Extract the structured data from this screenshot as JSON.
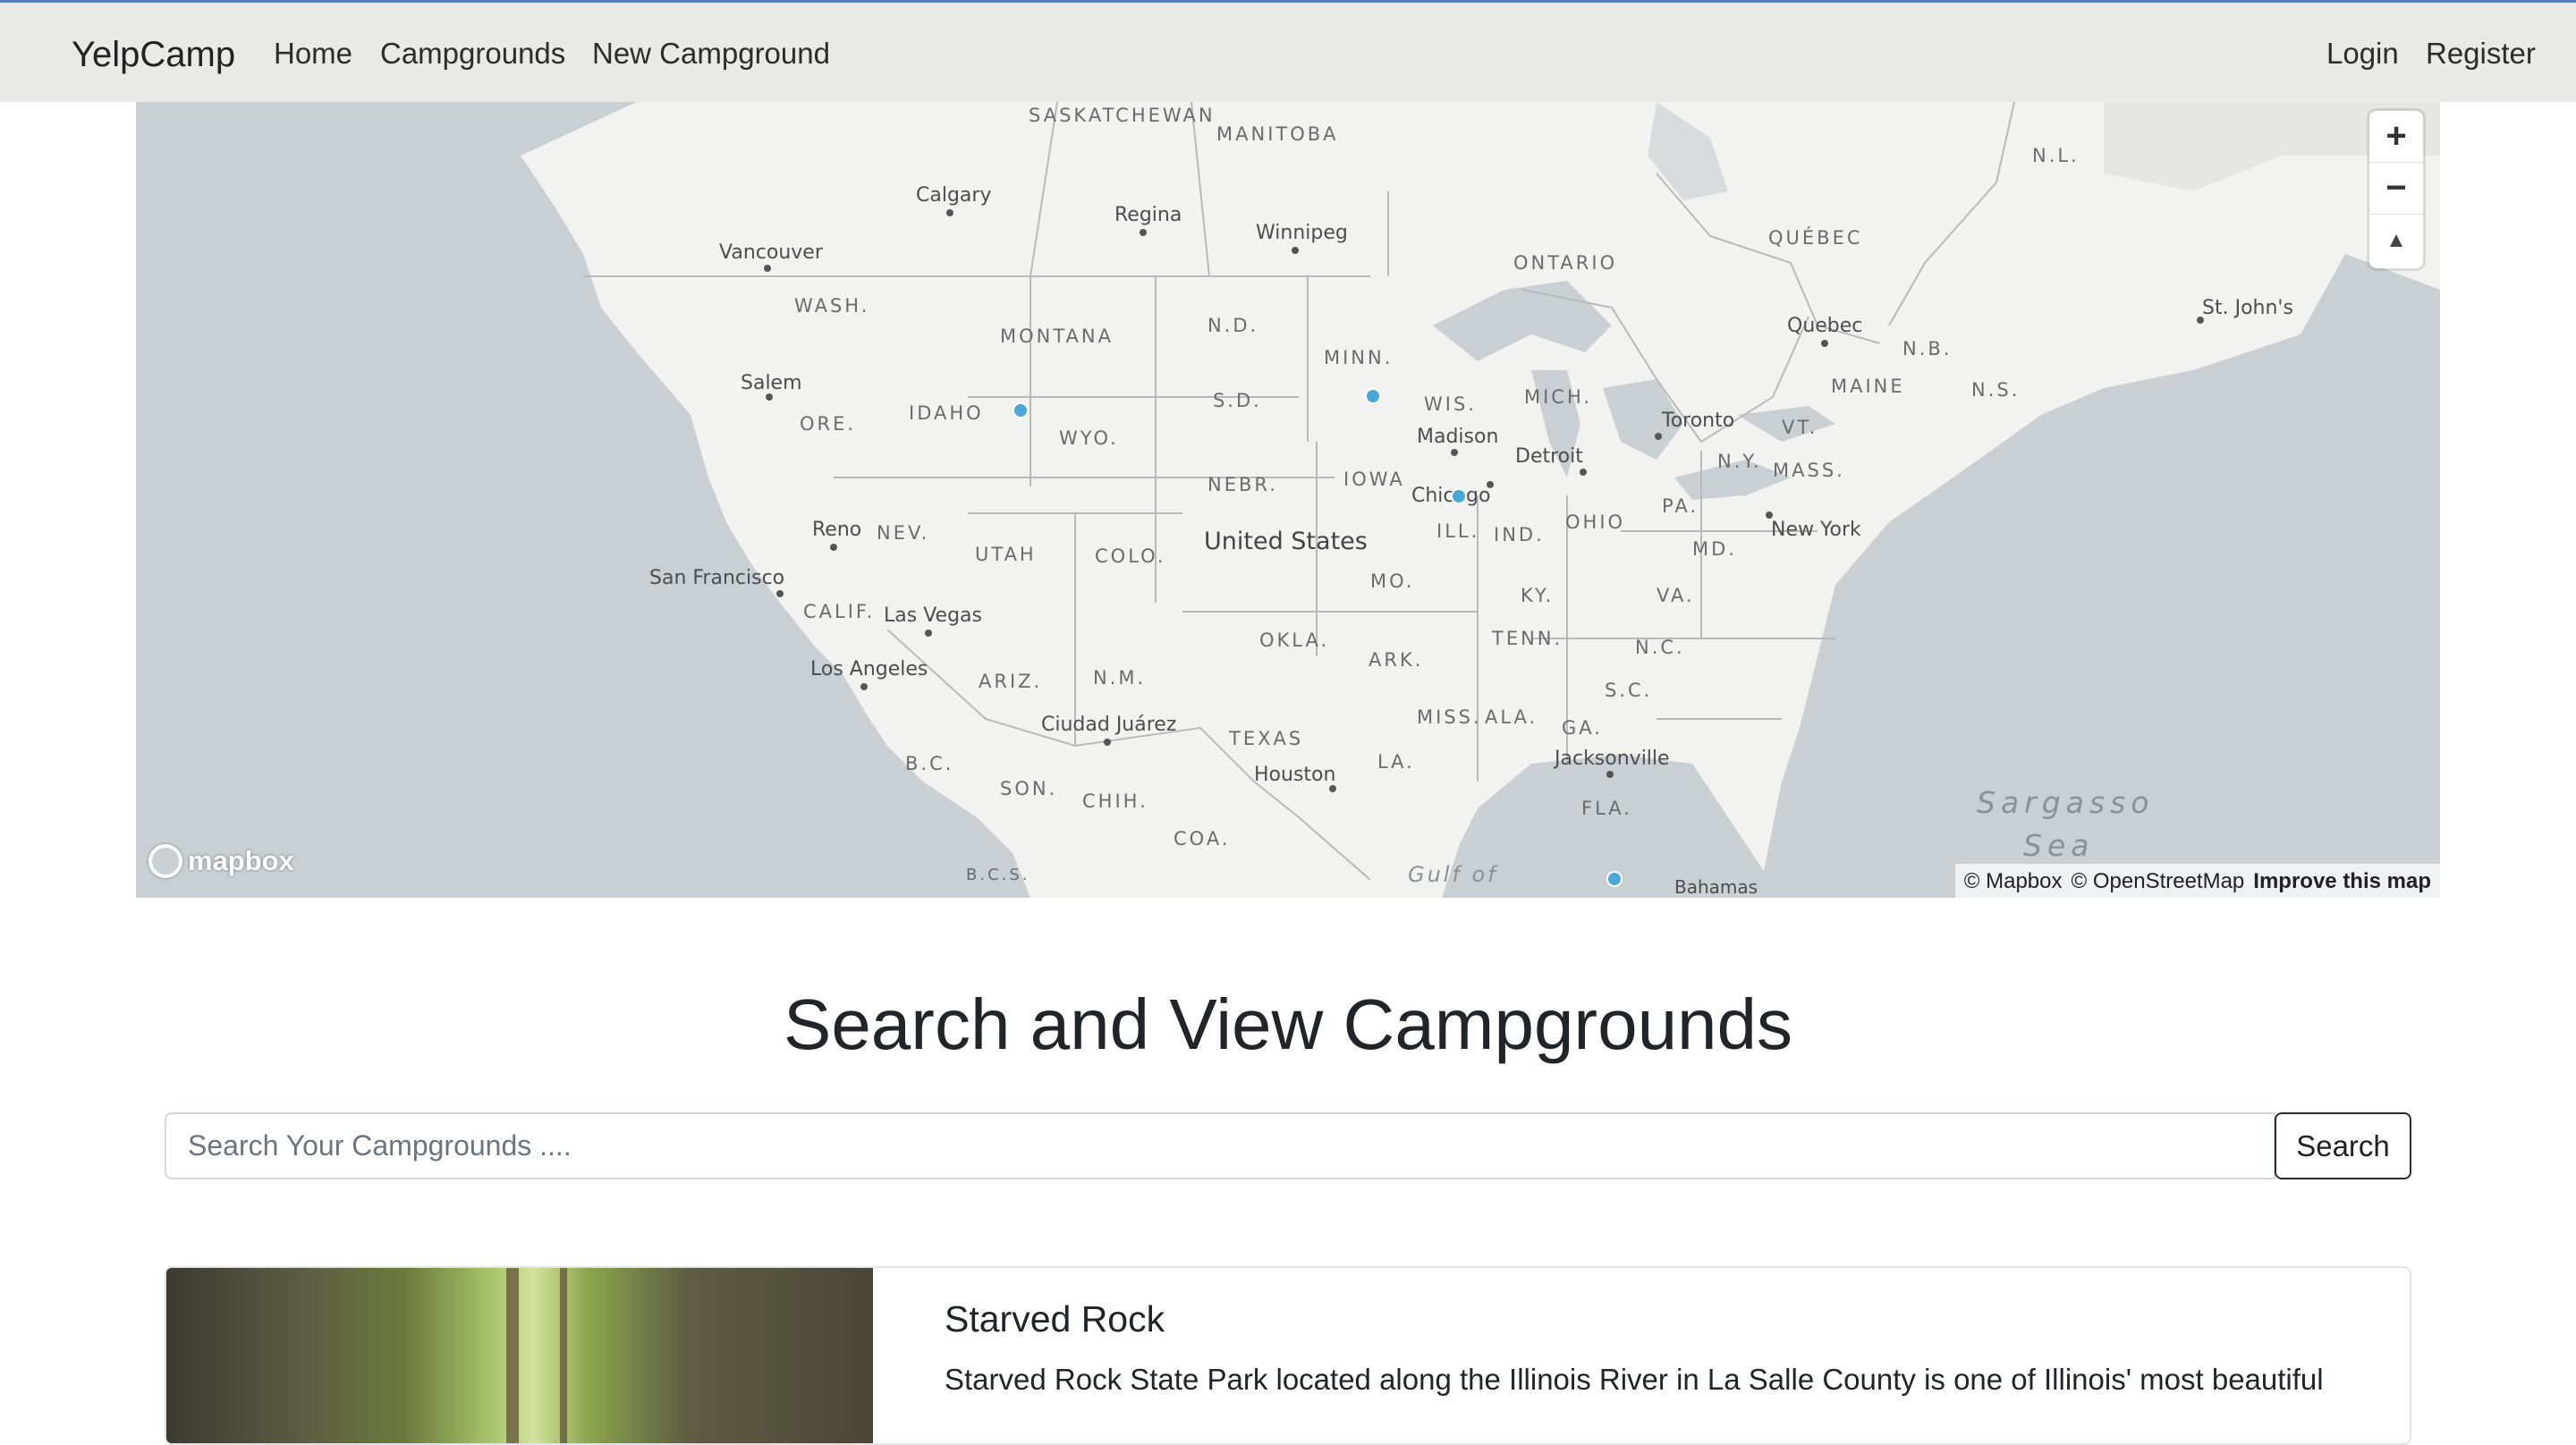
{
  "navbar": {
    "brand": "YelpCamp",
    "links": [
      "Home",
      "Campgrounds",
      "New Campground"
    ],
    "right_links": [
      "Login",
      "Register"
    ]
  },
  "map": {
    "regions": [
      "SASKATCHEWAN",
      "MANITOBA",
      "ONTARIO",
      "QUÉBEC",
      "N.L.",
      "N.B.",
      "N.S.",
      "MAINE",
      "VT.",
      "MASS.",
      "N.Y.",
      "PA.",
      "MD.",
      "VA.",
      "N.C.",
      "S.C.",
      "GA.",
      "FLA.",
      "ALA.",
      "MISS.",
      "TENN.",
      "KY.",
      "OHIO",
      "IND.",
      "ILL.",
      "MICH.",
      "WIS.",
      "MINN.",
      "IOWA",
      "MO.",
      "ARK.",
      "LA.",
      "OKLA.",
      "TEXAS",
      "N.M.",
      "ARIZ.",
      "COLO.",
      "UTAH",
      "NEV.",
      "CALIF.",
      "ORE.",
      "WASH.",
      "IDAHO",
      "MONTANA",
      "WYO.",
      "N.D.",
      "S.D.",
      "NEBR.",
      "B.C.",
      "SON.",
      "CHIH.",
      "COA.",
      "B.C.S."
    ],
    "cities": [
      "Calgary",
      "Regina",
      "Winnipeg",
      "Vancouver",
      "Salem",
      "Reno",
      "San Francisco",
      "Las Vegas",
      "Los Angeles",
      "Ciudad Juárez",
      "Houston",
      "Madison",
      "Chicago",
      "Detroit",
      "Toronto",
      "Quebec",
      "St. John's",
      "New York",
      "Jacksonville",
      "Bahamas"
    ],
    "country": "United States",
    "seas": [
      "Sargasso",
      "Sea",
      "Gulf of"
    ],
    "zoom_in": "+",
    "zoom_out": "−",
    "compass": "▲",
    "logo_text": "mapbox",
    "attribution": [
      "© Mapbox",
      "© OpenStreetMap"
    ],
    "improve_link": "Improve this map",
    "marker_color": "#4aa8d8"
  },
  "page_title": "Search and View Campgrounds",
  "search": {
    "placeholder": "Search Your Campgrounds ....",
    "button_label": "Search"
  },
  "campgrounds": [
    {
      "title": "Starved Rock",
      "description": "Starved Rock State Park located along the Illinois River in La Salle County is one of Illinois' most beautiful"
    }
  ]
}
